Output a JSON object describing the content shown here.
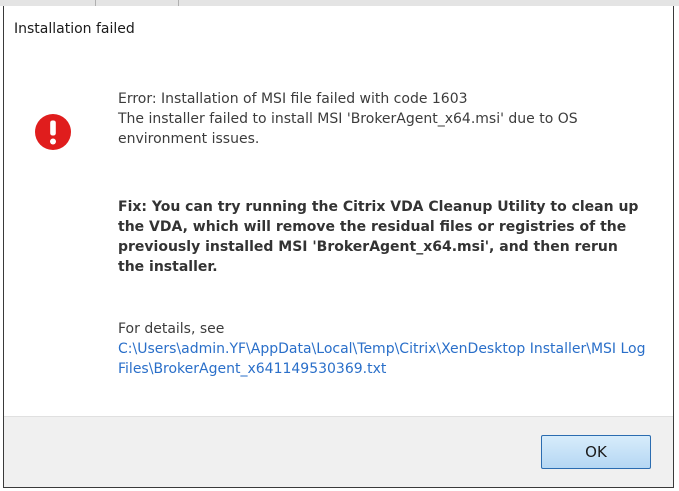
{
  "dialog": {
    "title": "Installation failed",
    "icon": "error-icon",
    "error_lines": [
      "Error: Installation of MSI file failed with code 1603",
      "The installer failed to install MSI 'BrokerAgent_x64.msi' due to OS environment issues."
    ],
    "fix_text": "Fix: You can try running the Citrix VDA Cleanup Utility to clean up the VDA, which will remove the residual files or registries of the previously installed MSI 'BrokerAgent_x64.msi', and then rerun the installer.",
    "details_label": "For details, see",
    "details_link": "C:\\Users\\admin.YF\\AppData\\Local\\Temp\\Citrix\\XenDesktop Installer\\MSI Log Files\\BrokerAgent_x641149530369.txt",
    "ok_label": "OK"
  },
  "colors": {
    "error_red": "#e01d1d",
    "link_blue": "#2a6fc9",
    "footer_bg": "#f0f0f0"
  }
}
